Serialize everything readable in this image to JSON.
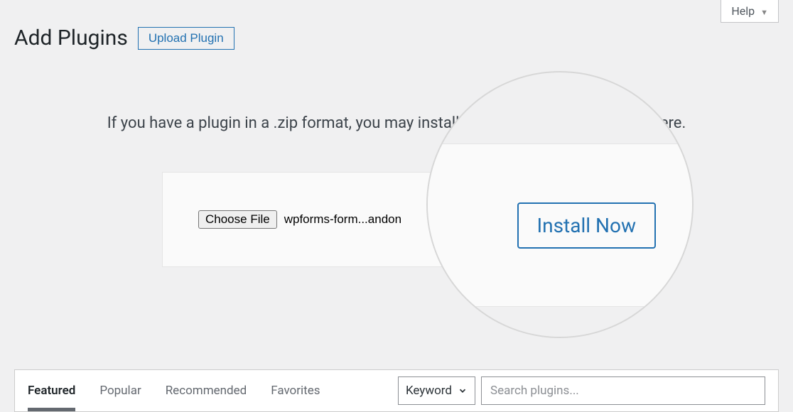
{
  "help": {
    "label": "Help"
  },
  "header": {
    "title": "Add Plugins",
    "upload_label": "Upload Plugin"
  },
  "upload": {
    "description": "If you have a plugin in a .zip format, you may install or update it by uploading it here.",
    "choose_file_label": "Choose File",
    "file_name": "wpforms-form...andon",
    "file_name_magnified_fragment": "andon",
    "install_label": "Install Now"
  },
  "tabs": {
    "items": [
      {
        "label": "Featured",
        "active": true
      },
      {
        "label": "Popular",
        "active": false
      },
      {
        "label": "Recommended",
        "active": false
      },
      {
        "label": "Favorites",
        "active": false
      }
    ]
  },
  "search": {
    "filter_label": "Keyword",
    "placeholder": "Search plugins..."
  }
}
